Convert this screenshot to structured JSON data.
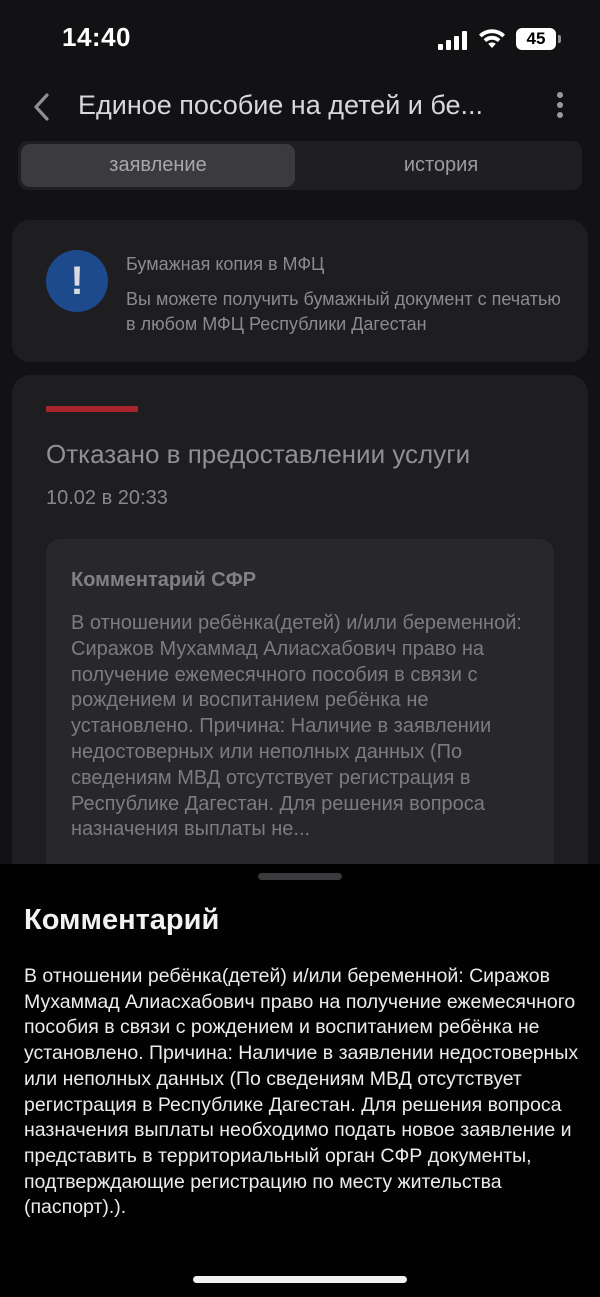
{
  "status_bar": {
    "time": "14:40",
    "battery": "45",
    "icons": [
      "signal-icon",
      "wifi-icon",
      "battery-icon"
    ]
  },
  "header": {
    "title": "Единое пособие на детей и бе...",
    "icons": [
      "chevron-left-icon",
      "more-vertical-icon"
    ]
  },
  "tabs": [
    {
      "label": "заявление",
      "active": true
    },
    {
      "label": "история",
      "active": false
    }
  ],
  "info_card": {
    "icon": "exclamation-icon",
    "title": "Бумажная копия в МФЦ",
    "text": "Вы можете получить бумажный документ с печатью в любом МФЦ Республики Дагестан"
  },
  "status_card": {
    "status": "Отказано в предоставлении услуги",
    "date": "10.02 в 20:33",
    "comment_title": "Комментарий СФР",
    "comment_preview": "В отношении ребёнка(детей) и/или беременной: Сиражов Мухаммад Алиасхабович право на получение ежемесячного пособия в связи с рождением и воспитанием ребёнка не установлено. Причина: Наличие в заявлении недостоверных или неполных данных (По сведениям МВД отсутствует регистрация в Республике Дагестан. Для решения вопроса назначения выплаты не..."
  },
  "sheet": {
    "title": "Комментарий",
    "text": "В отношении ребёнка(детей) и/или беременной: Сиражов Мухаммад Алиасхабович право на получение ежемесячного пособия в связи с рождением и воспитанием ребёнка не установлено. Причина: Наличие в заявлении недостоверных или неполных данных (По сведениям МВД отсутствует регистрация в Республике Дагестан. Для решения вопроса назначения выплаты необходимо подать новое заявление и представить в территориальный орган СФР документы, подтверждающие регистрацию по месту жительства (паспорт).)."
  },
  "colors": {
    "background": "#121214",
    "card": "#1e1e21",
    "sheet": "#020202",
    "accent_red": "#a8262b",
    "info_blue": "#1c4a8c"
  }
}
